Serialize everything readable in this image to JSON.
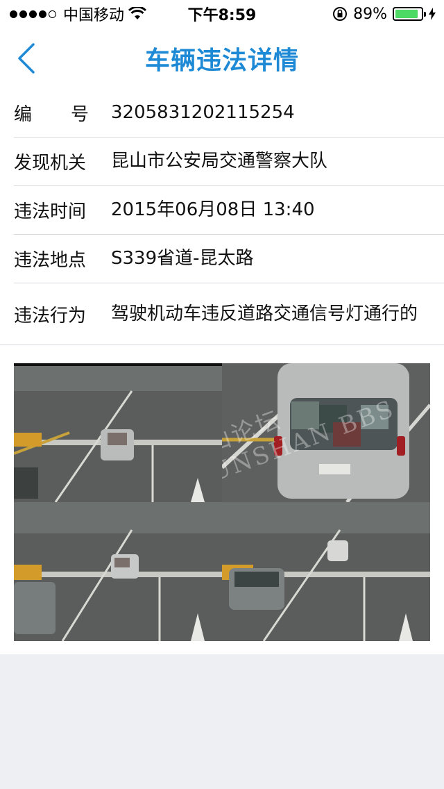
{
  "status_bar": {
    "carrier": "中国移动",
    "time": "下午8:59",
    "battery": "89%",
    "battery_level": 0.89,
    "signal_bars_filled": 4,
    "signal_bars_total": 5
  },
  "nav": {
    "title": "车辆违法详情",
    "back_icon": "chevron-left-icon",
    "accent_color": "#1e8ad6"
  },
  "details": {
    "number": {
      "label_a": "编",
      "label_b": "号",
      "value": "3205831202115254"
    },
    "authority": {
      "label": "发现机关",
      "value": "昆山市公安局交通警察大队"
    },
    "time": {
      "label": "违法时间",
      "value": "2015年06月08日 13:40"
    },
    "location": {
      "label": "违法地点",
      "value": "S339省道-昆太路"
    },
    "behavior": {
      "label": "违法行为",
      "value": "驾驶机动车违反道路交通信号灯通行的"
    }
  },
  "photos": {
    "watermark": "昆山论坛 KUNSHAN BBS"
  }
}
